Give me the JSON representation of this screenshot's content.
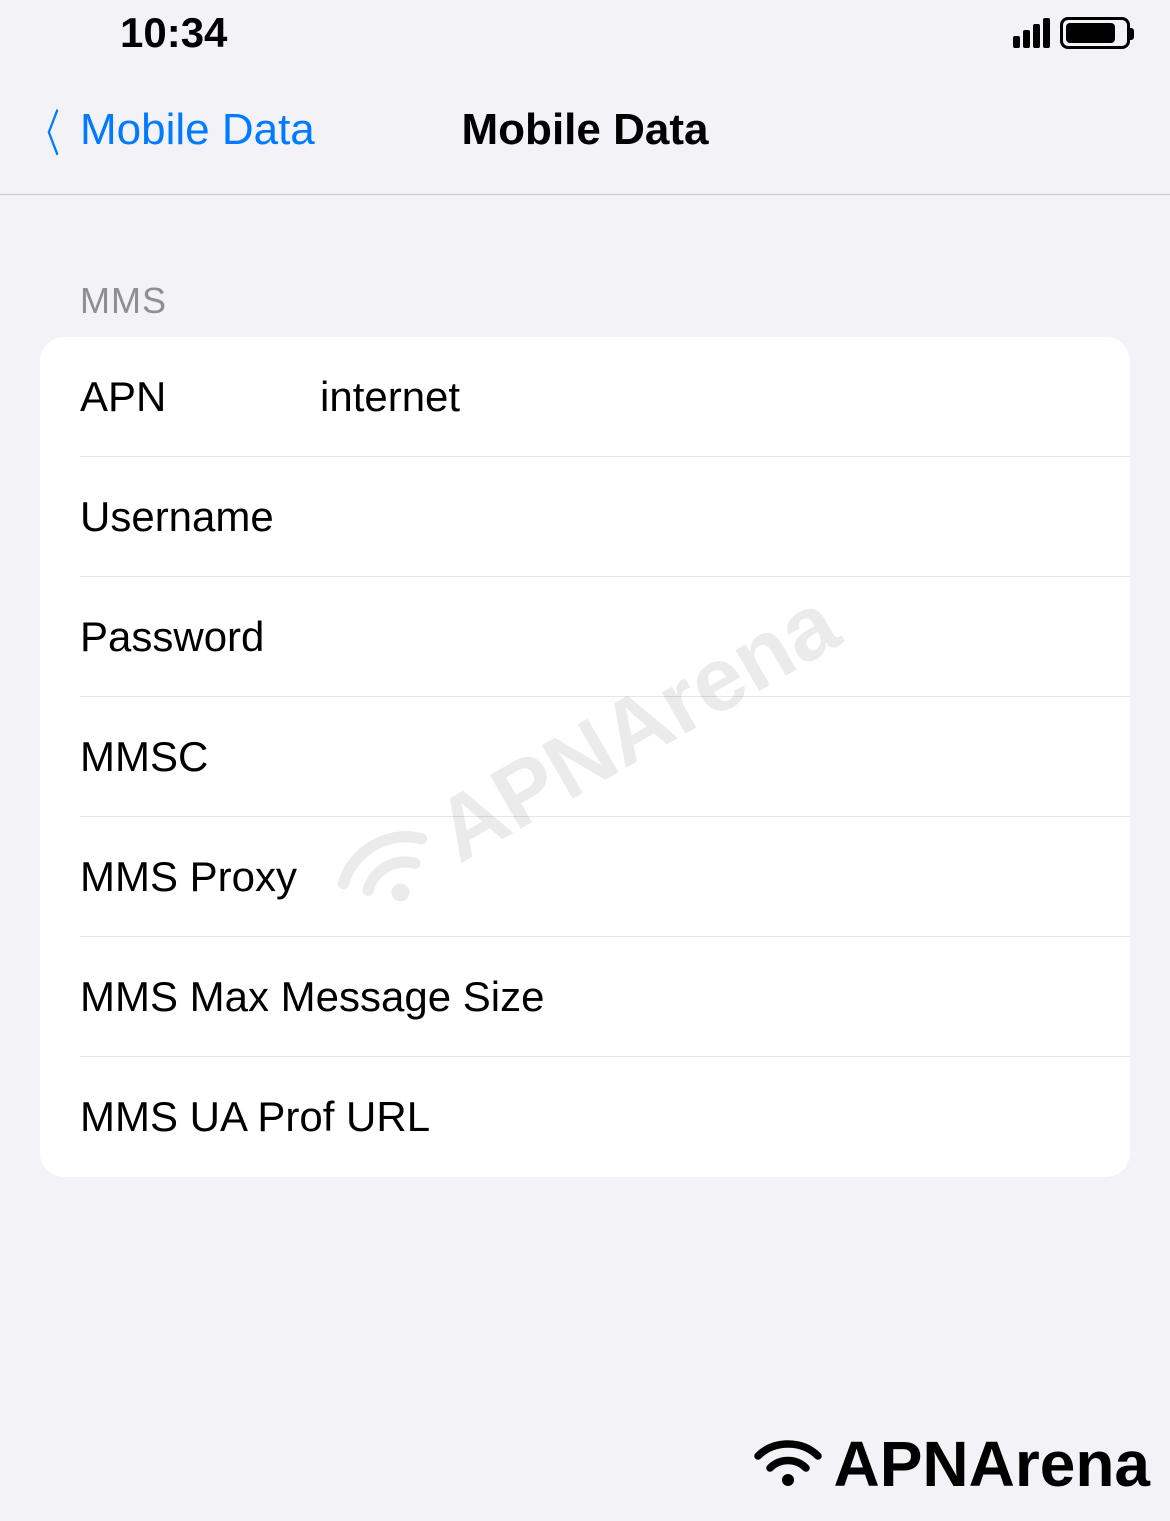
{
  "statusBar": {
    "time": "10:34"
  },
  "nav": {
    "backLabel": "Mobile Data",
    "title": "Mobile Data"
  },
  "section": {
    "header": "MMS"
  },
  "rows": {
    "apn": {
      "label": "APN",
      "value": "internet"
    },
    "username": {
      "label": "Username",
      "value": ""
    },
    "password": {
      "label": "Password",
      "value": ""
    },
    "mmsc": {
      "label": "MMSC",
      "value": ""
    },
    "mmsProxy": {
      "label": "MMS Proxy",
      "value": ""
    },
    "mmsMaxSize": {
      "label": "MMS Max Message Size",
      "value": ""
    },
    "mmsUaProf": {
      "label": "MMS UA Prof URL",
      "value": ""
    }
  },
  "watermark": {
    "text": "APNArena"
  },
  "footer": {
    "text": "APNArena"
  }
}
